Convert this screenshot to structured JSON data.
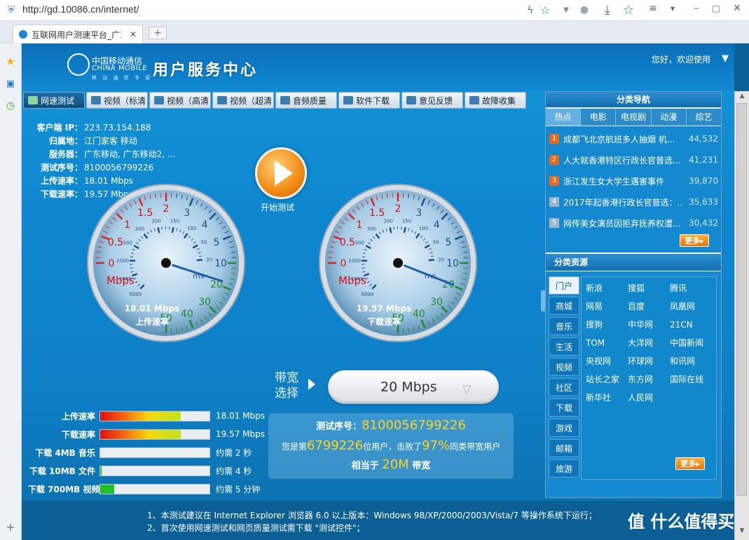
{
  "browser": {
    "url": "http://gd.10086.cn/internet/",
    "tab_title": "互联网用户测速平台_广东",
    "new_tab": "+"
  },
  "header": {
    "logo_cn": "中国移动通信",
    "logo_en": "CHINA MOBILE",
    "logo_sub": "移 动 通 信 专 家",
    "title": "用户服务中心",
    "welcome": "您好，欢迎使用"
  },
  "nav_tabs": [
    "网速测试",
    "视频（标清",
    "视频（高清",
    "视频（超清",
    "音频质量",
    "软件下载",
    "意见反馈",
    "故障收集"
  ],
  "info": [
    {
      "label": "客户端 IP：",
      "value": "223.73.154.188"
    },
    {
      "label": "归属地：",
      "value": "江门家客 移动"
    },
    {
      "label": "服务器：",
      "value": "广东移动, 广东移动2, ..."
    },
    {
      "label": "测试序号：",
      "value": "8100056799226"
    },
    {
      "label": "上传速率：",
      "value": "18.01 Mbps"
    },
    {
      "label": "下载速率：",
      "value": "19.57 Mbps"
    }
  ],
  "gauges": {
    "upload": {
      "reading": "18.01 Mbps",
      "caption": "上传速率",
      "value_mbps": 18.01
    },
    "download": {
      "reading": "19.57 Mbps",
      "caption": "下载速率",
      "value_mbps": 19.57
    },
    "unit_outer": "Mbps",
    "unit_inner": "ms",
    "outer_ticks": [
      "0",
      "0.5",
      "1",
      "1.5",
      "2",
      "3",
      "4",
      "5",
      "10",
      "20",
      "30",
      "40",
      "50"
    ],
    "inner_ticks": [
      "5000",
      "2000",
      "1000",
      "500",
      "300",
      "200",
      "150",
      "100",
      "50",
      "20"
    ]
  },
  "start_button": "开始测试",
  "bandwidth": {
    "label": "带宽选择",
    "value": "20 Mbps"
  },
  "result": {
    "seq_label": "测试序号：",
    "seq": "8100056799226",
    "rank_prefix": "您是第",
    "rank": "6799226",
    "rank_mid": "位用户，击败了",
    "percent": "97%",
    "rank_suffix": "同类带宽用户",
    "equiv_prefix": "相当于",
    "equiv": "20M",
    "equiv_suffix": "带宽"
  },
  "bars": [
    {
      "label": "上传速率",
      "value": "18.01 Mbps",
      "fill": 0.74,
      "type": "grad"
    },
    {
      "label": "下载速率",
      "value": "19.57 Mbps",
      "fill": 0.74,
      "type": "grad"
    },
    {
      "label": "下载 4MB 音乐",
      "value": "约需 2 秒",
      "fill": 0.0,
      "type": "green"
    },
    {
      "label": "下载 10MB 文件",
      "value": "约需 4 秒",
      "fill": 0.01,
      "type": "green"
    },
    {
      "label": "下载 700MB 视频",
      "value": "约需 5 分钟",
      "fill": 0.13,
      "type": "green"
    }
  ],
  "right": {
    "nav_title": "分类导航",
    "tabs": [
      "热点",
      "电影",
      "电视剧",
      "动漫",
      "综艺"
    ],
    "hot": [
      {
        "n": "1",
        "text": "成都飞北京航班多人抽烟 机...",
        "count": "44,532"
      },
      {
        "n": "2",
        "text": "人大就香港特区行政长官普选...",
        "count": "41,231"
      },
      {
        "n": "3",
        "text": "浙江发生女大学生遇害事件",
        "count": "39,870"
      },
      {
        "n": "4",
        "text": "2017年起香港行政长官普选：...",
        "count": "35,633"
      },
      {
        "n": "5",
        "text": "网传美女演员因拒弃抚养权遭...",
        "count": "30,432"
      }
    ],
    "more": "更多",
    "res_title": "分类资源",
    "res_cats": [
      "门户",
      "商城",
      "音乐",
      "生活",
      "视频",
      "社区",
      "下载",
      "游戏",
      "邮箱",
      "旅游"
    ],
    "res_links": [
      "新浪",
      "搜狐",
      "腾讯",
      "网易",
      "百度",
      "凤凰网",
      "搜狗",
      "中华网",
      "21CN",
      "TOM",
      "大洋网",
      "中国新闻",
      "央视网",
      "环球网",
      "和讯网",
      "站长之家",
      "东方网",
      "国际在线",
      "新华社",
      "人民网"
    ]
  },
  "notes": [
    "1、本测试建议在 Internet Explorer 浏览器 6.0 以上版本：Windows 98/XP/2000/2003/Vista/7 等操作系统下运行；",
    "2、首次使用网速测试和网页质量测试需下载 \"测试控件\"；"
  ],
  "watermark": "值 什么值得买",
  "colors": {
    "accent": "#1596d8",
    "highlight": "#ffd21f",
    "orange": "#f08a12"
  }
}
